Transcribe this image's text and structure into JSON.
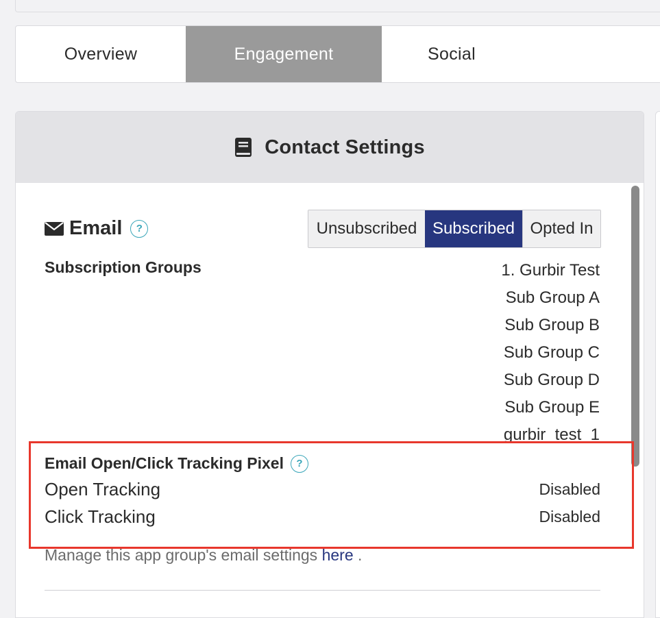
{
  "tabs": [
    {
      "label": "Overview"
    },
    {
      "label": "Engagement"
    },
    {
      "label": "Social"
    }
  ],
  "panel": {
    "title": "Contact Settings",
    "icon": "book-icon"
  },
  "email": {
    "label": "Email",
    "help": "?",
    "subscription_state": {
      "options": [
        "Unsubscribed",
        "Subscribed",
        "Opted In"
      ],
      "selected": "Subscribed"
    },
    "subscription_groups_label": "Subscription Groups",
    "groups": [
      "1. Gurbir Test",
      "Sub Group A",
      "Sub Group B",
      "Sub Group C",
      "Sub Group D",
      "Sub Group E",
      "gurbir_test_1"
    ]
  },
  "tracking": {
    "title": "Email Open/Click Tracking Pixel",
    "help": "?",
    "rows": [
      {
        "label": "Open Tracking",
        "value": "Disabled"
      },
      {
        "label": "Click Tracking",
        "value": "Disabled"
      }
    ]
  },
  "manage": {
    "prefix": "Manage this app group's email settings",
    "link": "here",
    "suffix": "."
  },
  "colors": {
    "active_tab": "#9a9a9a",
    "selected_segment": "#27367f",
    "help_accent": "#3aa6b9",
    "highlight": "#e8372c"
  }
}
